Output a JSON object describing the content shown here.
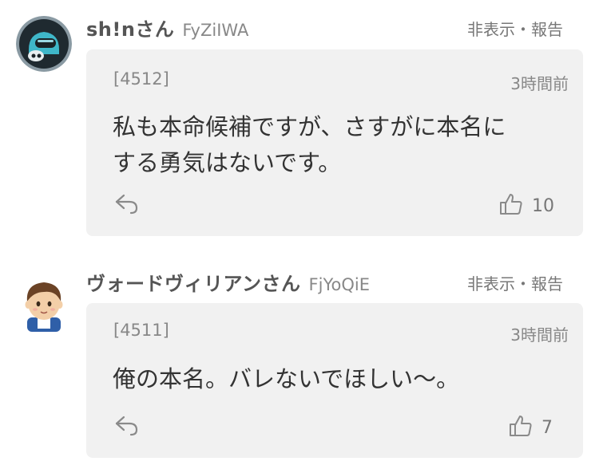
{
  "comments": [
    {
      "username": "sh!nさん",
      "user_id": "FyZiIWA",
      "report_label": "非表示・報告",
      "number": "[4512]",
      "time": "3時間前",
      "text_line1": "私も本命候補ですが、さすがに本名に",
      "text_line2": "する勇気はないです。",
      "likes": "10",
      "avatar_icon": "robot-avatar-icon",
      "reply_icon": "reply-icon",
      "like_icon": "thumbs-up-icon"
    },
    {
      "username": "ヴォードヴィリアンさん",
      "user_id": "FjYoQiE",
      "report_label": "非表示・報告",
      "number": "[4511]",
      "time": "3時間前",
      "text_line1": "俺の本名。バレないでほしい〜。",
      "likes": "7",
      "avatar_icon": "person-avatar-icon",
      "reply_icon": "reply-icon",
      "like_icon": "thumbs-up-icon"
    }
  ],
  "colors": {
    "card_background": "#f1f1f1",
    "text": "#333333",
    "muted": "#888888"
  }
}
